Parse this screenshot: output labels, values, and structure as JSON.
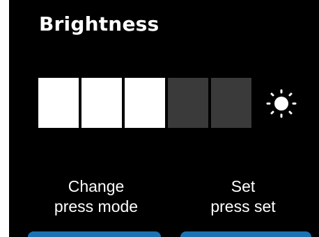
{
  "screen": {
    "title": "Brightness"
  },
  "brightness": {
    "level": 3,
    "max": 5,
    "icon": "sun-icon"
  },
  "hints": {
    "left_line1": "Change",
    "left_line2": "press mode",
    "right_line1": "Set",
    "right_line2": "press set"
  },
  "colors": {
    "background": "#000000",
    "segment_on": "#ffffff",
    "segment_off": "#3a3a3a",
    "softkey": "#1c73b4"
  }
}
